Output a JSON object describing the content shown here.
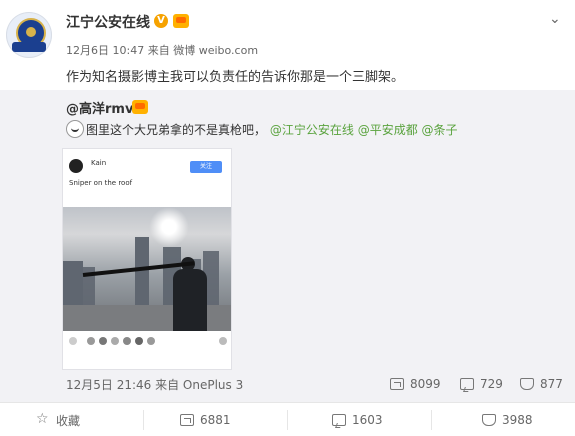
{
  "post": {
    "author": "江宁公安在线",
    "badges": [
      "verified-v-icon",
      "member-crown-icon"
    ],
    "timestamp": "12月6日 10:47",
    "source_prefix": "来自",
    "source": "微博 weibo.com",
    "text": "作为知名摄影博主我可以负责任的告诉你那是一个三脚架。",
    "more_icon": "chevron-down-icon"
  },
  "repost": {
    "author": "@高洋rmvb",
    "text_prefix": "图里这个大兄弟拿的不是真枪吧，",
    "mentions": [
      "@江宁公安在线",
      "@平安成都",
      "@条子"
    ],
    "embedded_screenshot": {
      "username": "Kain",
      "subtitle": "",
      "follow_label": "关注",
      "caption": "Sniper on the roof",
      "small_text": "",
      "reply_text": ""
    },
    "meta": "12月5日 21:46 来自 OnePlus 3",
    "stats": {
      "forwards": "8099",
      "comments": "729",
      "likes": "877"
    }
  },
  "actions": {
    "favorite_label": "收藏",
    "forward_count": "6881",
    "comment_count": "1603",
    "like_count": "3988"
  },
  "colors": {
    "mention_green": "#5aa33e",
    "repost_bg": "#f2f2f5",
    "badge_orange": "#f6a200"
  }
}
